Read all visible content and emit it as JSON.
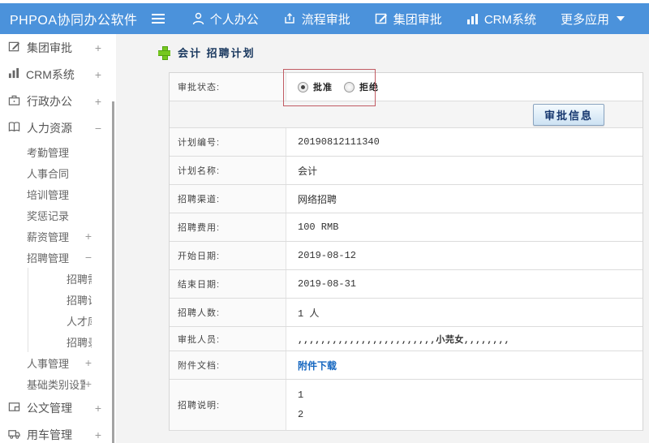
{
  "header": {
    "logo": "PHPOA协同办公软件",
    "menu": [
      {
        "label": "个人办公",
        "icon": "user-icon"
      },
      {
        "label": "流程审批",
        "icon": "process-icon"
      },
      {
        "label": "集团审批",
        "icon": "edit-square-icon"
      },
      {
        "label": "CRM系统",
        "icon": "bar-chart-icon"
      },
      {
        "label": "更多应用",
        "icon": "caret-down-icon"
      }
    ]
  },
  "sidebar": {
    "items": [
      {
        "label": "集团审批",
        "level": 1,
        "toggle": "+",
        "icon": "edit-square-icon"
      },
      {
        "label": "CRM系统",
        "level": 1,
        "toggle": "+",
        "icon": "bar-chart-icon"
      },
      {
        "label": "行政办公",
        "level": 1,
        "toggle": "+",
        "icon": "briefcase-icon"
      },
      {
        "label": "人力资源",
        "level": 1,
        "toggle": "−",
        "icon": "book-icon"
      },
      {
        "label": "考勤管理",
        "level": 2,
        "toggle": ""
      },
      {
        "label": "人事合同",
        "level": 2,
        "toggle": ""
      },
      {
        "label": "培训管理",
        "level": 2,
        "toggle": ""
      },
      {
        "label": "奖惩记录",
        "level": 2,
        "toggle": ""
      },
      {
        "label": "薪资管理",
        "level": 2,
        "toggle": "+"
      },
      {
        "label": "招聘管理",
        "level": 2,
        "toggle": "−"
      },
      {
        "label": "招聘需求",
        "level": 3,
        "toggle": ""
      },
      {
        "label": "招聘计划",
        "level": 3,
        "toggle": ""
      },
      {
        "label": "人才库",
        "level": 3,
        "toggle": ""
      },
      {
        "label": "招聘录用",
        "level": 3,
        "toggle": ""
      },
      {
        "label": "人事管理",
        "level": 2,
        "toggle": "+"
      },
      {
        "label": "基础类别设置",
        "level": 2,
        "toggle": "+"
      },
      {
        "label": "公文管理",
        "level": 1,
        "toggle": "+",
        "icon": "document-icon"
      },
      {
        "label": "用车管理",
        "level": 1,
        "toggle": "+",
        "icon": "truck-icon"
      }
    ]
  },
  "main": {
    "title": "会计 招聘计划",
    "approve_button": "审批信息",
    "form": {
      "status_label": "审批状态:",
      "radio_approve": "批准",
      "radio_reject": "拒绝",
      "radio_selected": "批准",
      "rows": [
        {
          "label": "计划编号:",
          "value": "20190812111340"
        },
        {
          "label": "计划名称:",
          "value": "会计"
        },
        {
          "label": "招聘渠道:",
          "value": "网络招聘"
        },
        {
          "label": "招聘费用:",
          "value": "100 RMB"
        },
        {
          "label": "开始日期:",
          "value": "2019-08-12"
        },
        {
          "label": "结束日期:",
          "value": "2019-08-31"
        },
        {
          "label": "招聘人数:",
          "value": "1 人"
        },
        {
          "label": "审批人员:",
          "value": ",,,,,,,,,,,,,,,,,,,,,,,,小芫女,,,,,,,,"
        }
      ],
      "attachment": {
        "label": "附件文档:",
        "link": "附件下载"
      },
      "description": {
        "label": "招聘说明:",
        "lines": [
          "1",
          "2"
        ]
      }
    }
  },
  "colors": {
    "header_bg": "#4b92db",
    "title_text": "#17365d",
    "link": "#1667c0",
    "annotation_red_box": "#c15b63",
    "plus_icon_green": "#76c81e"
  }
}
